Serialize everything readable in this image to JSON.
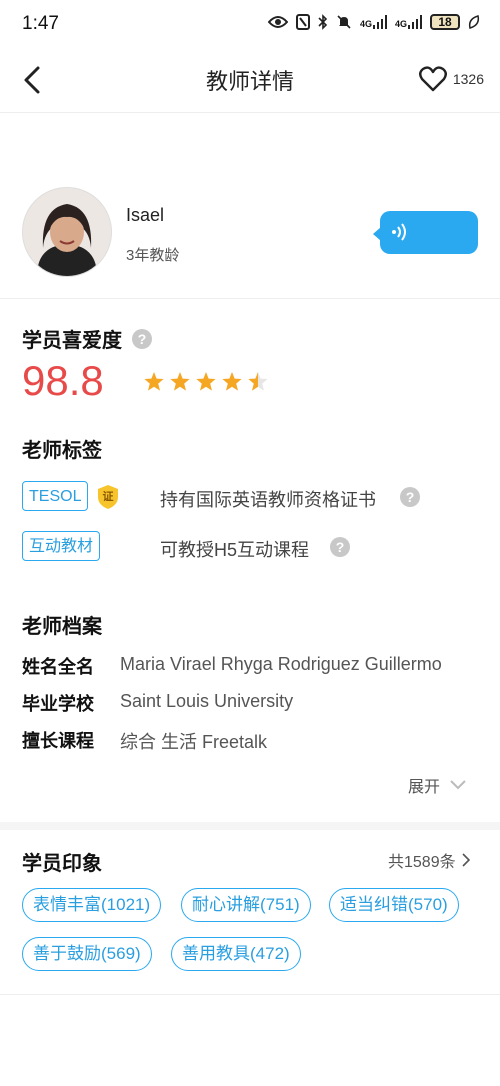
{
  "status_bar": {
    "time": "1:47",
    "network_a": "4G",
    "network_b": "4G",
    "battery": "18"
  },
  "header": {
    "title": "教师详情",
    "like_count": "1326"
  },
  "teacher": {
    "name": "Isael",
    "experience": "3年教龄"
  },
  "popularity": {
    "title": "学员喜爱度",
    "score": "98.8",
    "stars": 4.5
  },
  "tags": {
    "title": "老师标签",
    "cert_icon_text": "证",
    "items": [
      {
        "label": "TESOL",
        "description": "持有国际英语教师资格证书"
      },
      {
        "label": "互动教材",
        "description": "可教授H5互动课程"
      }
    ]
  },
  "profile": {
    "title": "老师档案",
    "rows": [
      {
        "label": "姓名全名",
        "value": "Maria Virael Rhyga Rodriguez Guillermo"
      },
      {
        "label": "毕业学校",
        "value": "Saint Louis University"
      },
      {
        "label": "擅长课程",
        "value": "综合 生活 Freetalk"
      }
    ],
    "expand_label": "展开"
  },
  "impressions": {
    "title": "学员印象",
    "total": "共1589条",
    "items": [
      "表情丰富(1021)",
      "耐心讲解(751)",
      "适当纠错(570)",
      "善于鼓励(569)",
      "善用教具(472)"
    ]
  },
  "colors": {
    "accent": "#2aa9f0",
    "score": "#e84a4a",
    "star": "#f5a623"
  }
}
